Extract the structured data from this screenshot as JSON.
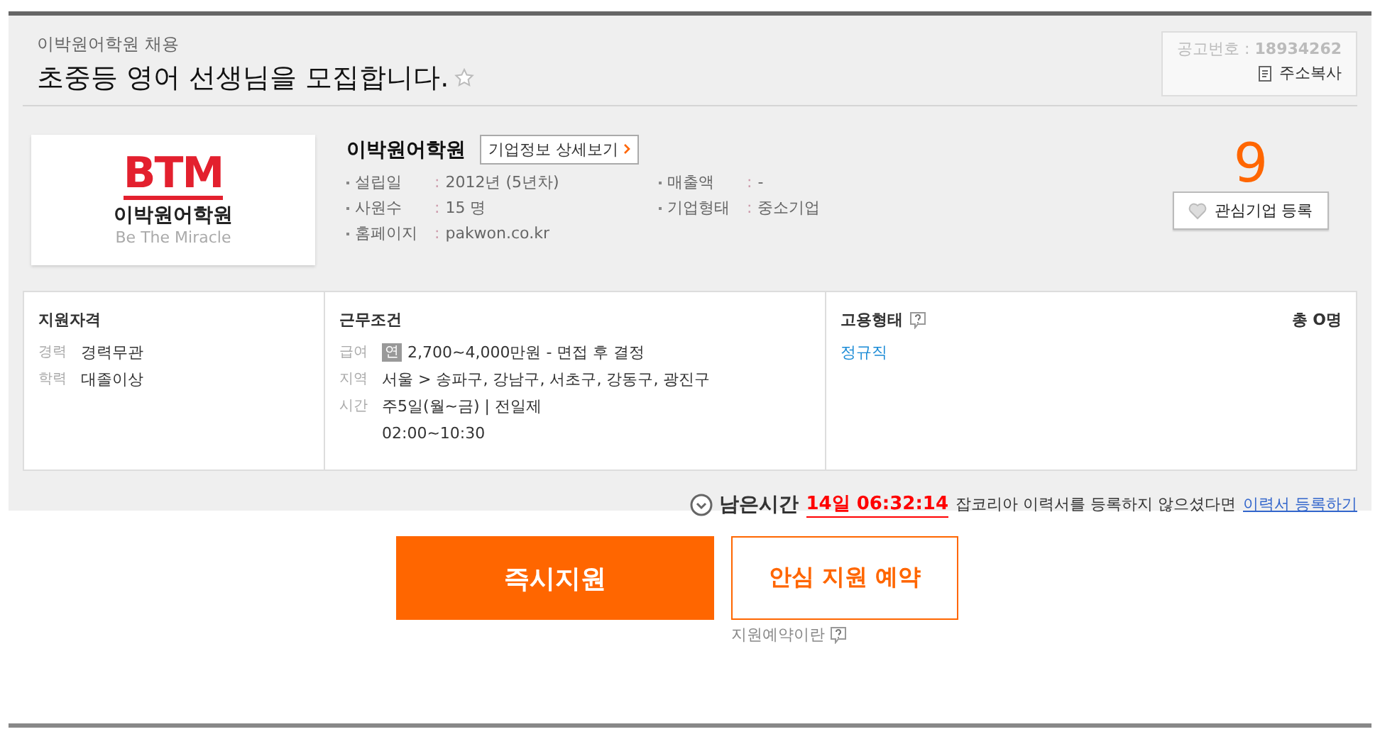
{
  "header": {
    "company_line": "이박원어학원 채용",
    "title": "초중등 영어 선생님을 모집합니다.",
    "favorite": false,
    "notice_number_label": "공고번호 :",
    "notice_number": "18934262",
    "copy_address": "주소복사"
  },
  "company": {
    "logo": {
      "mark": "BTM",
      "name": "이박원어학원",
      "tagline": "Be The Miracle"
    },
    "name": "이박원어학원",
    "detail_button": "기업정보 상세보기",
    "facts": [
      {
        "label": "설립일",
        "sep": ":",
        "value": "2012년 (5년차)"
      },
      {
        "label": "매출액",
        "sep": ":",
        "value": "-"
      },
      {
        "label": "사원수",
        "sep": ":",
        "value": "15 명"
      },
      {
        "label": "기업형태",
        "sep": ":",
        "value": "중소기업"
      },
      {
        "label": "홈페이지",
        "sep": ":",
        "value": "pakwon.co.kr"
      }
    ],
    "interest_count": "9",
    "interest_button": "관심기업 등록"
  },
  "sections": [
    {
      "title": "지원자격",
      "rows": [
        {
          "label": "경력",
          "value": "경력무관"
        },
        {
          "label": "학력",
          "value": "대졸이상"
        }
      ]
    },
    {
      "title": "근무조건",
      "rows": [
        {
          "label": "급여",
          "badge": "연",
          "value": "2,700~4,000만원 - 면접 후 결정"
        },
        {
          "label": "지역",
          "value": "서울 > 송파구, 강남구, 서초구, 강동구, 광진구"
        },
        {
          "label": "시간",
          "value": "주5일(월~금) | 전일제"
        },
        {
          "value": "02:00~10:30"
        }
      ]
    },
    {
      "title": "고용형태",
      "help": true,
      "headcount": "총 O명",
      "rows": [
        {
          "kind": "link",
          "value": "정규직"
        }
      ]
    }
  ],
  "deadline": {
    "label": "남은시간",
    "remaining": "14일 06:32:14",
    "note": "잡코리아 이력서를 등록하지 않으셨다면",
    "link": "이력서 등록하기"
  },
  "actions": {
    "apply": "즉시지원",
    "reserve": "안심 지원 예약",
    "reserve_help": "지원예약이란"
  }
}
